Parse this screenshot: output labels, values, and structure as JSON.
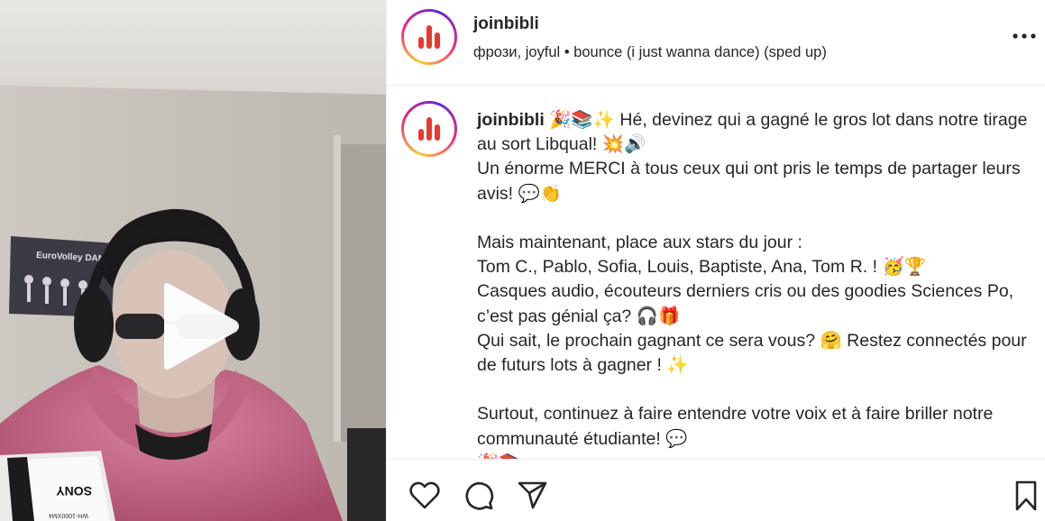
{
  "post": {
    "username": "joinbibli",
    "audio": {
      "artist": "фрози, joyful",
      "separator": "•",
      "track": "bounce (i just wanna dance) (sped up)"
    }
  },
  "caption": {
    "username": "joinbibli",
    "text": " 🎉📚✨ Hé, devinez qui a gagné le gros lot dans notre tirage au sort Libqual! 💥🔊\nUn énorme MERCI à tous ceux qui ont pris le temps de partager leurs avis! 💬👏\n\nMais maintenant, place aux stars du jour :\nTom C., Pablo, Sofia, Louis, Baptiste, Ana, Tom R. ! 🥳🏆\nCasques audio, écouteurs derniers cris ou des goodies Sciences Po, c’est pas génial ça? 🎧🎁\nQui sait, le prochain gagnant ce sera vous? 🤗 Restez connectés pour de futurs lots à gagner ! ✨\n\nSurtout, continuez à faire entendre votre voix et à faire briller notre communauté étudiante! 💬\n🎉📚"
  },
  "media": {
    "headphone_box_brand": "SONY",
    "headphone_box_model": "WH-1000XM4",
    "poster_text": "EuroVolley DANCE"
  },
  "icons": {
    "play": "play-icon",
    "more": "more-options-icon",
    "like": "heart-icon",
    "comment": "comment-icon",
    "share": "share-icon",
    "save": "bookmark-icon"
  },
  "colors": {
    "text": "#262626",
    "avatar_ring_start": "#f9ce34",
    "avatar_ring_mid": "#ee2a7b",
    "logo_red": "#e8392f",
    "divider": "#efefef"
  }
}
